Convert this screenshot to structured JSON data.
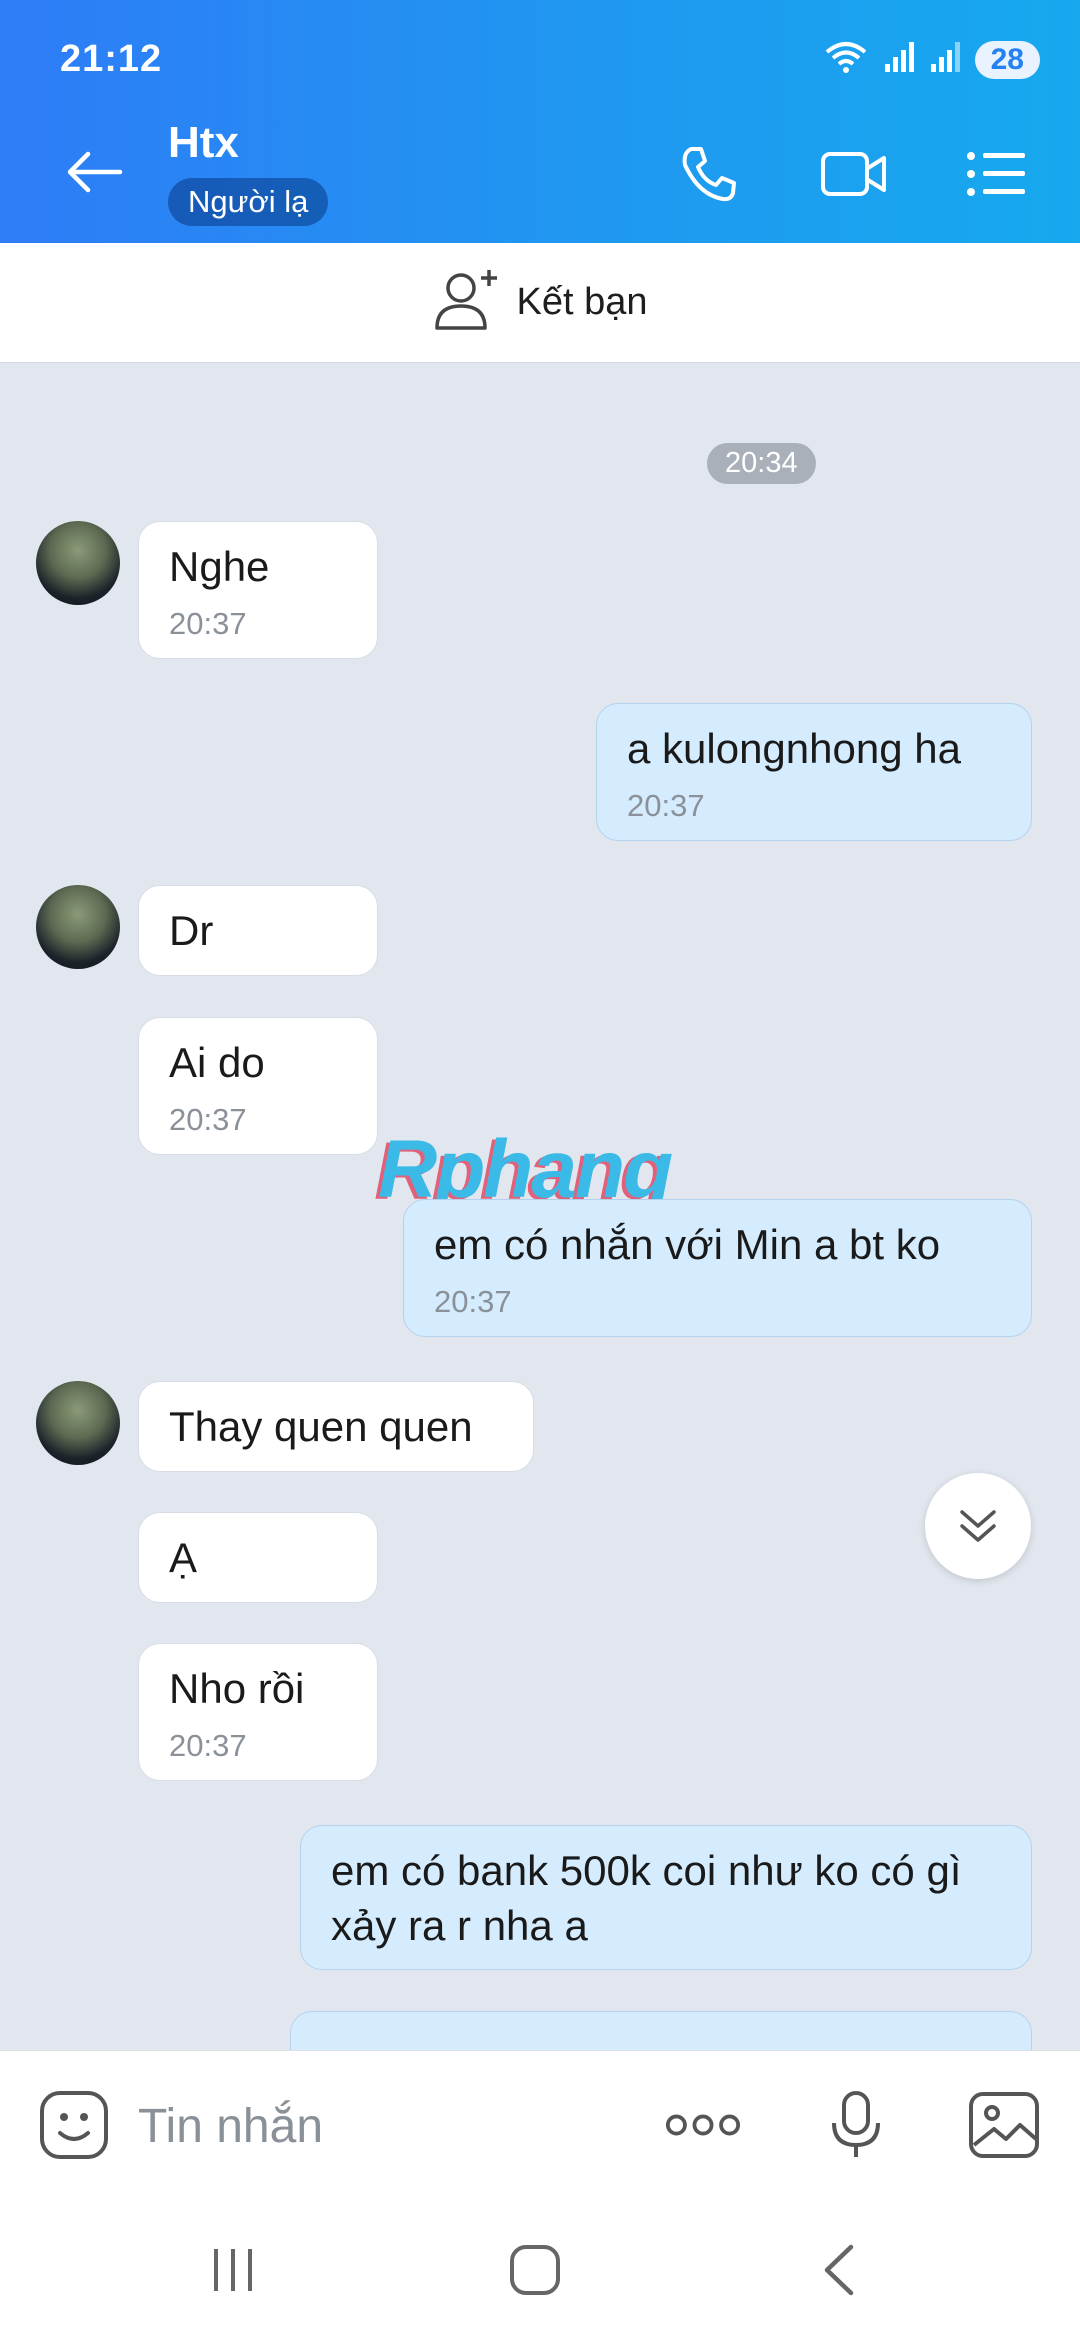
{
  "status": {
    "time": "21:12",
    "battery": "28"
  },
  "header": {
    "title": "Htx",
    "subtitle": "Người lạ"
  },
  "friend_bar": {
    "label": "Kết bạn"
  },
  "chat": {
    "date_chip": "20:34",
    "watermark": "Rphang",
    "messages": [
      {
        "dir": "in",
        "text": "Nghe",
        "time": "20:37"
      },
      {
        "dir": "out",
        "text": "a kulongnhong ha",
        "time": "20:37"
      },
      {
        "dir": "in",
        "text": "Dr",
        "time": ""
      },
      {
        "dir": "in",
        "text": "Ai do",
        "time": "20:37"
      },
      {
        "dir": "out",
        "text": "em có nhắn với Min a bt ko",
        "time": "20:37"
      },
      {
        "dir": "in",
        "text": "Thay quen quen",
        "time": ""
      },
      {
        "dir": "in",
        "text": "Ạ",
        "time": ""
      },
      {
        "dir": "in",
        "text": "Nho rồi",
        "time": "20:37"
      },
      {
        "dir": "out",
        "text": "em có bank 500k coi như ko có gì xảy ra r nha a",
        "time": ""
      }
    ]
  },
  "composer": {
    "placeholder": "Tin nhắn"
  }
}
